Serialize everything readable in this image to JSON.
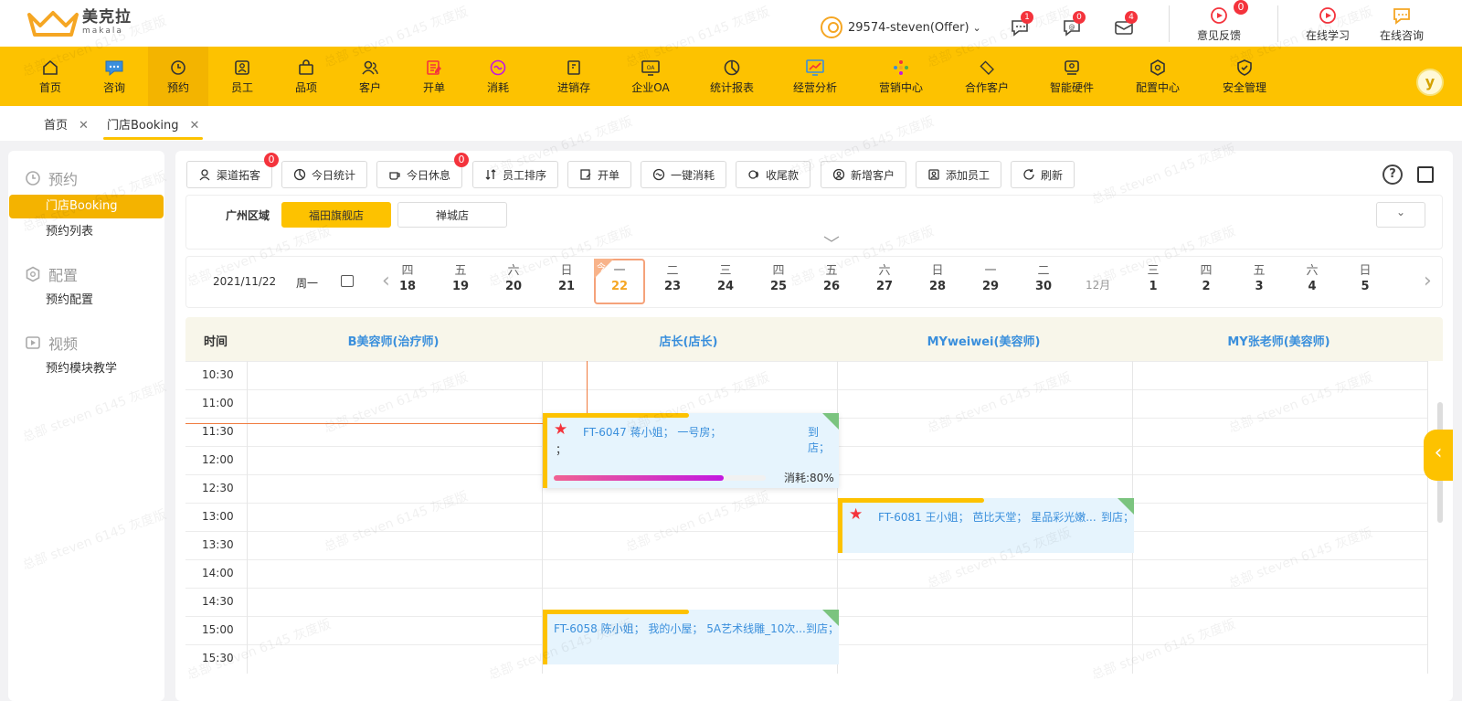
{
  "brand": {
    "name_cn": "美克拉",
    "name_en": "makala"
  },
  "header": {
    "user": "29574-steven(Offer)",
    "icons": [
      {
        "name": "chat-icon",
        "badge": "1"
      },
      {
        "name": "consult-icon",
        "badge": "0"
      },
      {
        "name": "mail-icon",
        "badge": "4"
      }
    ],
    "feedback": {
      "label": "意见反馈",
      "badge": "0"
    },
    "learning": {
      "label": "在线学习"
    },
    "consult": {
      "label": "在线咨询"
    }
  },
  "nav": [
    {
      "label": "首页",
      "icon": "home-icon"
    },
    {
      "label": "咨询",
      "icon": "consult-icon"
    },
    {
      "label": "预约",
      "icon": "clock-icon",
      "active": true
    },
    {
      "label": "员工",
      "icon": "staff-icon"
    },
    {
      "label": "品项",
      "icon": "bag-icon"
    },
    {
      "label": "客户",
      "icon": "customer-icon"
    },
    {
      "label": "开单",
      "icon": "order-icon"
    },
    {
      "label": "消耗",
      "icon": "consume-icon"
    },
    {
      "label": "进销存",
      "icon": "inventory-icon"
    },
    {
      "label": "企业OA",
      "icon": "oa-icon"
    },
    {
      "label": "统计报表",
      "icon": "report-icon"
    },
    {
      "label": "经营分析",
      "icon": "analysis-icon"
    },
    {
      "label": "营销中心",
      "icon": "marketing-icon"
    },
    {
      "label": "合作客户",
      "icon": "partner-icon"
    },
    {
      "label": "智能硬件",
      "icon": "hardware-icon"
    },
    {
      "label": "配置中心",
      "icon": "config-icon"
    },
    {
      "label": "安全管理",
      "icon": "security-icon"
    }
  ],
  "nav_avatar": "y",
  "tabs": [
    {
      "label": "首页"
    },
    {
      "label": "门店Booking",
      "active": true
    }
  ],
  "sidebar": {
    "groups": [
      {
        "label": "预约",
        "items": [
          "门店Booking",
          "预约列表"
        ]
      },
      {
        "label": "配置",
        "items": [
          "预约配置"
        ]
      },
      {
        "label": "视频",
        "items": [
          "预约模块教学"
        ]
      }
    ]
  },
  "actions": [
    {
      "label": "渠道拓客",
      "badge": "0"
    },
    {
      "label": "今日统计"
    },
    {
      "label": "今日休息",
      "badge": "0"
    },
    {
      "label": "员工排序"
    },
    {
      "label": "开单"
    },
    {
      "label": "一键消耗"
    },
    {
      "label": "收尾款"
    },
    {
      "label": "新增客户"
    },
    {
      "label": "添加员工"
    },
    {
      "label": "刷新"
    }
  ],
  "region": "广州区域",
  "stores": [
    {
      "label": "福田旗舰店",
      "active": true
    },
    {
      "label": "禅城店"
    }
  ],
  "date": {
    "current": "2021/11/22",
    "weekday": "周一",
    "month_label": "12月",
    "today_tag": "今"
  },
  "days": [
    {
      "w": "四",
      "d": "18"
    },
    {
      "w": "五",
      "d": "19"
    },
    {
      "w": "六",
      "d": "20"
    },
    {
      "w": "日",
      "d": "21"
    },
    {
      "w": "一",
      "d": "22",
      "today": true
    },
    {
      "w": "二",
      "d": "23"
    },
    {
      "w": "三",
      "d": "24"
    },
    {
      "w": "四",
      "d": "25"
    },
    {
      "w": "五",
      "d": "26"
    },
    {
      "w": "六",
      "d": "27"
    },
    {
      "w": "日",
      "d": "28"
    },
    {
      "w": "一",
      "d": "29"
    },
    {
      "w": "二",
      "d": "30"
    },
    {
      "w": "三",
      "d": "1"
    },
    {
      "w": "四",
      "d": "2"
    },
    {
      "w": "五",
      "d": "3"
    },
    {
      "w": "六",
      "d": "4"
    },
    {
      "w": "日",
      "d": "5"
    }
  ],
  "schedule": {
    "time_header": "时间",
    "staff": [
      "B美容师(治疗师)",
      "店长(店长)",
      "MYweiwei(美容师)",
      "MY张老师(美容师)"
    ],
    "times": [
      "10:30",
      "11:00",
      "11:30",
      "12:00",
      "12:30",
      "13:00",
      "13:30",
      "14:00",
      "14:30",
      "15:00",
      "15:30"
    ],
    "bookings": [
      {
        "text": "FT-6047 蒋小姐； 一号房；",
        "status": "到店；",
        "semi": "；",
        "progress_label": "消耗:80%",
        "progress": 0.8
      },
      {
        "text": "FT-6081 王小姐； 芭比天堂； 星品彩光嫩...",
        "status": "到店；"
      },
      {
        "text": "FT-6058 陈小姐； 我的小屋； 5A艺术线雕_10次...",
        "status": "到店；"
      }
    ]
  },
  "watermark": "总部 steven 6145 灰度版"
}
